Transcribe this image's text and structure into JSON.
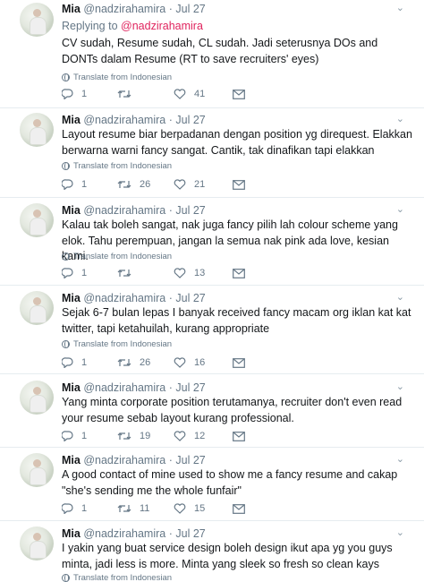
{
  "tweets": [
    {
      "name": "Mia",
      "handle": "@nadzirahamira",
      "dot": "·",
      "date": "Jul 27",
      "reply_label": "Replying to",
      "reply_handle": "@nadzirahamira",
      "text": "CV sudah, Resume sudah, CL sudah. Jadi seterusnya DOs and DONTs dalam Resume (RT to save recruiters' eyes)",
      "translate": "Translate from Indonesian",
      "replies": "1",
      "retweets": "",
      "likes": "41"
    },
    {
      "name": "Mia",
      "handle": "@nadzirahamira",
      "dot": "·",
      "date": "Jul 27",
      "text": "Layout resume biar berpadanan dengan position yg direquest. Elakkan berwarna warni fancy sangat. Cantik, tak dinafikan tapi elakkan",
      "translate": "Translate from Indonesian",
      "replies": "1",
      "retweets": "26",
      "likes": "21"
    },
    {
      "name": "Mia",
      "handle": "@nadzirahamira",
      "dot": "·",
      "date": "Jul 27",
      "text": "Kalau tak boleh sangat, nak juga fancy pilih lah colour scheme yang elok. Tahu perempuan, jangan la semua nak pink ada love, kesian kami.",
      "translate": "Translate from Indonesian",
      "replies": "1",
      "retweets": "",
      "likes": "13"
    },
    {
      "name": "Mia",
      "handle": "@nadzirahamira",
      "dot": "·",
      "date": "Jul 27",
      "text": "Sejak 6-7 bulan lepas I banyak received fancy macam org iklan kat kat twitter, tapi ketahuilah, kurang appropriate",
      "translate": "Translate from Indonesian",
      "replies": "1",
      "retweets": "26",
      "likes": "16"
    },
    {
      "name": "Mia",
      "handle": "@nadzirahamira",
      "dot": "·",
      "date": "Jul 27",
      "text": "Yang minta corporate position terutamanya, recruiter don't even read your resume sebab layout kurang professional.",
      "translate": "",
      "replies": "1",
      "retweets": "19",
      "likes": "12"
    },
    {
      "name": "Mia",
      "handle": "@nadzirahamira",
      "dot": "·",
      "date": "Jul 27",
      "text": "A good contact of mine used to show me a fancy resume and cakap \"she's sending me the whole funfair\"",
      "translate": "",
      "replies": "1",
      "retweets": "11",
      "likes": "15"
    },
    {
      "name": "Mia",
      "handle": "@nadzirahamira",
      "dot": "·",
      "date": "Jul 27",
      "text": "I yakin yang buat service design boleh design ikut apa yg you guys minta, jadi less is more. Minta yang sleek so fresh so clean kays",
      "translate": "Translate from Indonesian",
      "replies": "",
      "retweets": "",
      "likes": ""
    }
  ],
  "icons": {
    "reply": "reply-icon",
    "retweet": "retweet-icon",
    "like": "heart-icon",
    "dm": "envelope-icon",
    "menu": "chevron-down-icon",
    "translate": "globe-icon"
  },
  "colors": {
    "reply_link": "#e0245e",
    "muted": "#657786",
    "text": "#14171a",
    "divider": "#e6ecf0"
  }
}
